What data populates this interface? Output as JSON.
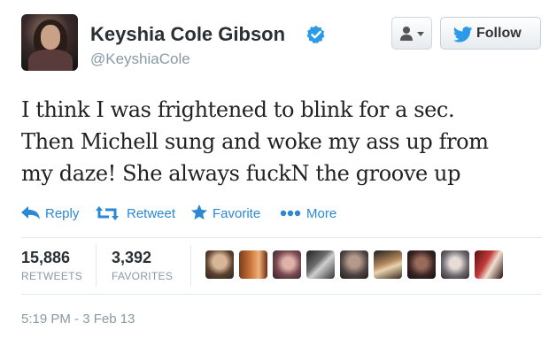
{
  "user": {
    "name": "Keyshia Cole Gibson",
    "handle": "@KeyshiaCole",
    "verified": true
  },
  "buttons": {
    "follow_label": "Follow"
  },
  "tweet": {
    "lines": [
      "I think I was frightened to blink for a sec.",
      "Then Michell sung and woke my ass up from",
      "my daze! She always fuckN the groove up"
    ]
  },
  "actions": {
    "reply": "Reply",
    "retweet": "Retweet",
    "favorite": "Favorite",
    "more": "More"
  },
  "stats": {
    "retweets_count": "15,886",
    "retweets_label": "RETWEETS",
    "favorites_count": "3,392",
    "favorites_label": "FAVORITES"
  },
  "favoriters_count_shown": 9,
  "timestamp": "5:19 PM - 3 Feb 13",
  "colors": {
    "link": "#2a88d4",
    "verified": "#2b9ae8",
    "muted": "#8899a6",
    "twitter_bird": "#2b9ae8"
  },
  "icons": {
    "verified": "verified-badge-icon",
    "user_menu": "user-dropdown-icon",
    "follow": "twitter-bird-icon",
    "reply": "reply-arrow-icon",
    "retweet": "retweet-icon",
    "favorite": "star-icon",
    "more": "ellipsis-icon"
  }
}
